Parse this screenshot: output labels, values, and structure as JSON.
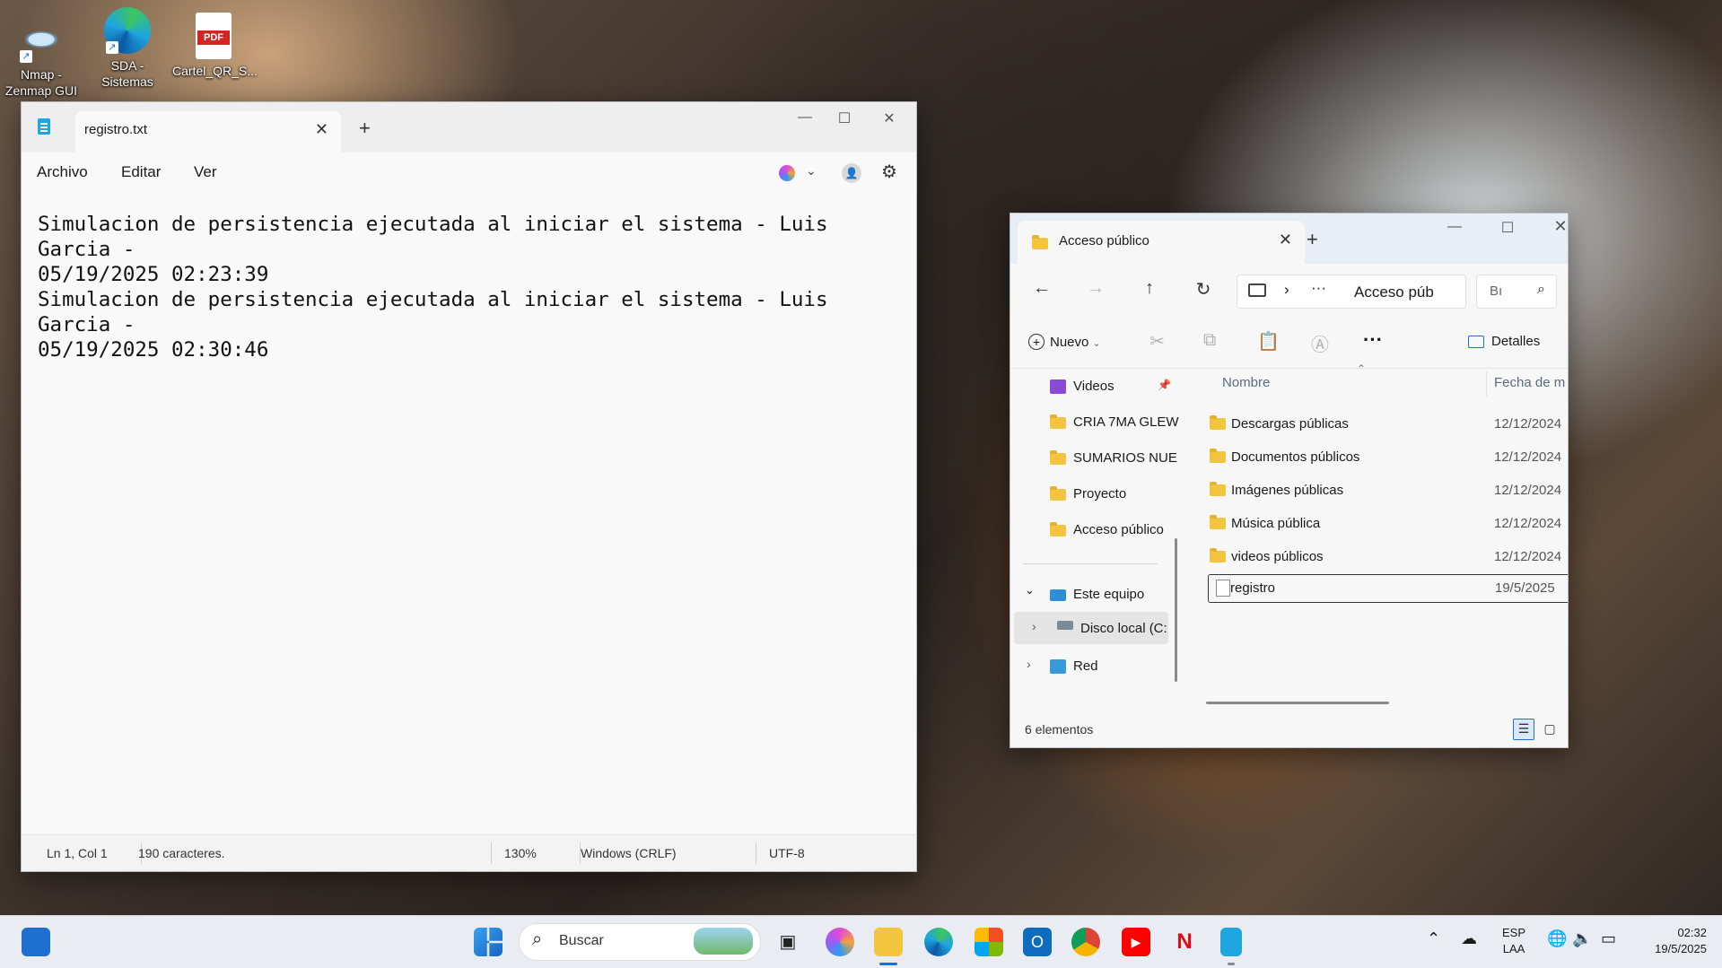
{
  "desktop": {
    "icons": [
      {
        "label": "Nmap - Zenmap GUI",
        "icon": "nmap-eye-icon"
      },
      {
        "label": "SDA - Sistemas",
        "icon": "edge-icon"
      },
      {
        "label": "Cartel_QR_S...",
        "icon": "pdf-icon",
        "badge": "PDF"
      }
    ]
  },
  "notepad": {
    "tab_title": "registro.txt",
    "menu": [
      "Archivo",
      "Editar",
      "Ver"
    ],
    "content": "Simulacion de persistencia ejecutada al iniciar el sistema - Luis Garcia -\n05/19/2025 02:23:39\nSimulacion de persistencia ejecutada al iniciar el sistema - Luis Garcia -\n05/19/2025 02:30:46",
    "status": {
      "position": "Ln 1, Col 1",
      "chars": "190 caracteres.",
      "zoom": "130%",
      "line_ending": "Windows (CRLF)",
      "encoding": "UTF-8"
    }
  },
  "explorer": {
    "tab_title": "Acceso público",
    "address": "Acceso púb",
    "search_placeholder": "Bı",
    "toolbar": {
      "new_label": "Nuevo",
      "details_label": "Detalles"
    },
    "nav_items": [
      {
        "label": "Videos",
        "pinned": true
      },
      {
        "label": "CRIA 7MA GLEW"
      },
      {
        "label": "SUMARIOS NUE"
      },
      {
        "label": "Proyecto"
      },
      {
        "label": "Acceso público"
      },
      {
        "label": "Este equipo"
      },
      {
        "label": "Disco local (C:"
      },
      {
        "label": "Red"
      }
    ],
    "columns": {
      "name": "Nombre",
      "date": "Fecha de m"
    },
    "files": [
      {
        "name": "Descargas públicas",
        "date": "12/12/2024",
        "type": "folder"
      },
      {
        "name": "Documentos públicos",
        "date": "12/12/2024",
        "type": "folder"
      },
      {
        "name": "Imágenes públicas",
        "date": "12/12/2024",
        "type": "folder"
      },
      {
        "name": "Música pública",
        "date": "12/12/2024",
        "type": "folder"
      },
      {
        "name": "videos públicos",
        "date": "12/12/2024",
        "type": "folder"
      },
      {
        "name": "registro",
        "date": "19/5/2025",
        "type": "file",
        "selected": true
      }
    ],
    "status": "6 elementos"
  },
  "taskbar": {
    "search_placeholder": "Buscar",
    "lang_top": "ESP",
    "lang_bottom": "LAA",
    "time": "02:32",
    "date": "19/5/2025"
  }
}
